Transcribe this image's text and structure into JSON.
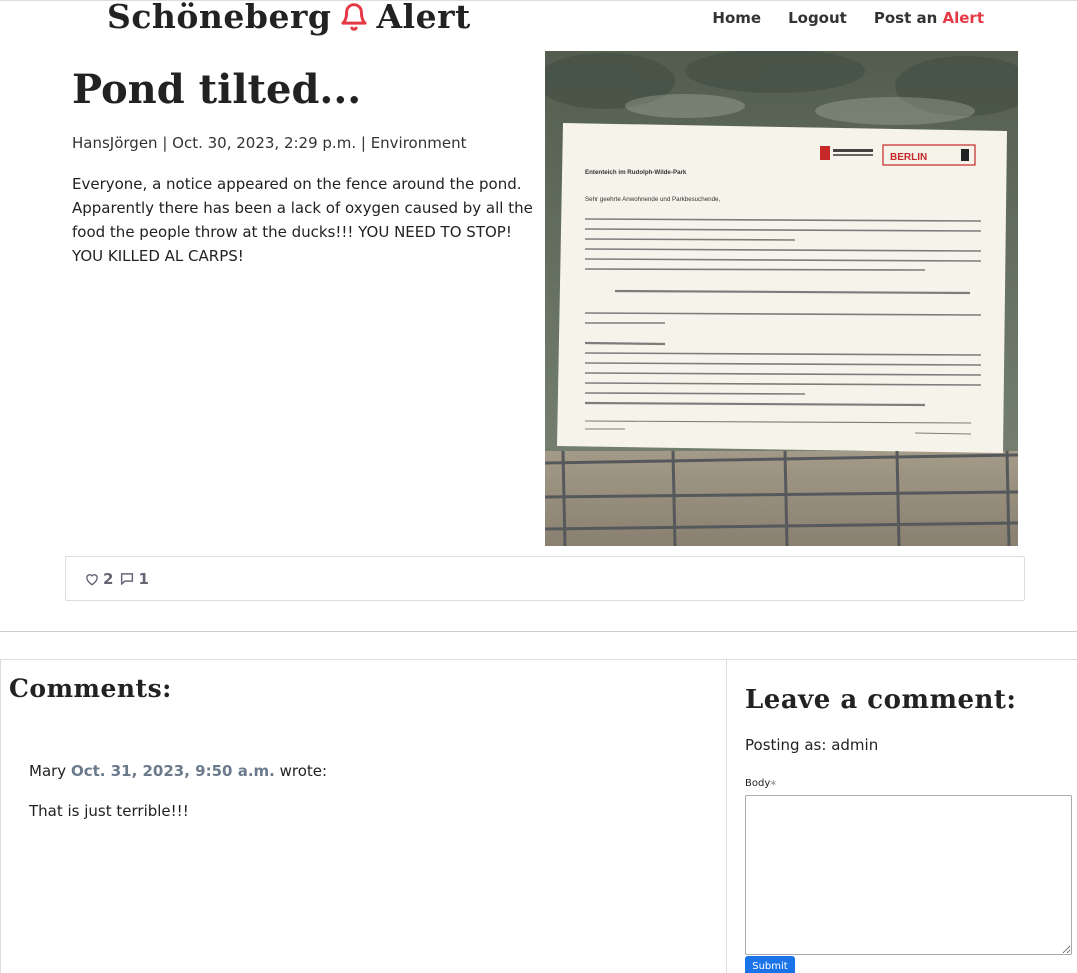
{
  "brand": {
    "part1": "Schöneberg",
    "icon": "bell-icon",
    "part2": "Alert"
  },
  "nav": {
    "home": "Home",
    "logout": "Logout",
    "post_prefix": "Post an",
    "post_accent": "Alert"
  },
  "post": {
    "title": "Pond tilted...",
    "author": "HansJörgen",
    "date": "Oct. 30, 2023, 2:29 p.m.",
    "category": "Environment",
    "body": "Everyone, a notice appeared on the fence around the pond. Apparently there has been a lack of oxygen caused by all the food the people throw at the ducks!!! YOU NEED TO STOP! YOU KILLED AL CARPS!",
    "likes": "2",
    "comments_count": "1",
    "image": {
      "notice_title": "Ententeich im Rudolph-Wilde-Park",
      "logo_text": "BERLIN",
      "greeting": "Sehr geehrte Anwohnende und Parkbesuchende,",
      "para1": "aufgrund eines technischen Defektes an der Pumpstation inkl. Sauerstoffanreicherung ist das Teichwasser im Ententeich „gekippt\". Die ersten Proben ergaben, dass der Sauerstoff-Wert des Wassers deutlich zu gering war.",
      "para2": "Zum Schutz und Erhalt der Flora und Fauna wurde unverzüglich eine Belüftungsanlage in der Mitte des Teichs installiert, um den Sauerstoff-Wert im Gewässer wieder zu erhöhen. Weitere Probeentnahmen und eine abschließende Bewertung sind bereits eingeleitet worden.",
      "bold_line": "Wir bitten um Verständnis, dass der Teich bis auf Weiteres gesperrt bleiben muss.",
      "para3": "Das Gewässer steht unter permanenter Beobachtung, weitere Informationen werden wir zeitnah veröffentlichen.",
      "hint_title": "Wichtiger Hinweis:",
      "hint": "Das Füttern von Wasservögeln hat ebenfalls negative Auswirkungen auf unsere Seen, Flüsse und Teiche. Verschmähtes Brot, das im Wasser auf den Grund sinkt, und die vermehrten Ausscheidungen der Vögel regen das Algenwachstum stark an. Dadurch wird den Gewässern lebensnotwendiger Sauerstoff entzogen, sie werden grün und „kippen plötzlich um\". Pflanzen, Fische und viele andere stille Wasserbewohner sterben dann.",
      "hint_bold": "Bitte verzichten Sie daher auf das Füttern von Wasservögeln. Danke!",
      "contact": "Auskunft erhalten Sie beim Umwelt- und Naturschutzamt & Fachbereich Grünflächen Email: fb-gruen@ba-ts.berlin.de / umwelt@ba-ts.berlin.de",
      "stand": "Stand August 2023"
    }
  },
  "comments": {
    "heading": "Comments:",
    "items": [
      {
        "author": "Mary",
        "date": "Oct. 31, 2023, 9:50 a.m.",
        "wrote": "wrote:",
        "body": "That is just terrible!!!"
      }
    ]
  },
  "form": {
    "heading": "Leave a comment:",
    "posting_as_label": "Posting as:",
    "posting_as_user": "admin",
    "body_label": "Body",
    "required_mark": "*",
    "body_value": "",
    "submit_label": "Submit"
  },
  "colors": {
    "accent": "#e63946",
    "link_muted": "#6b7b8c",
    "button": "#1a73e8"
  }
}
